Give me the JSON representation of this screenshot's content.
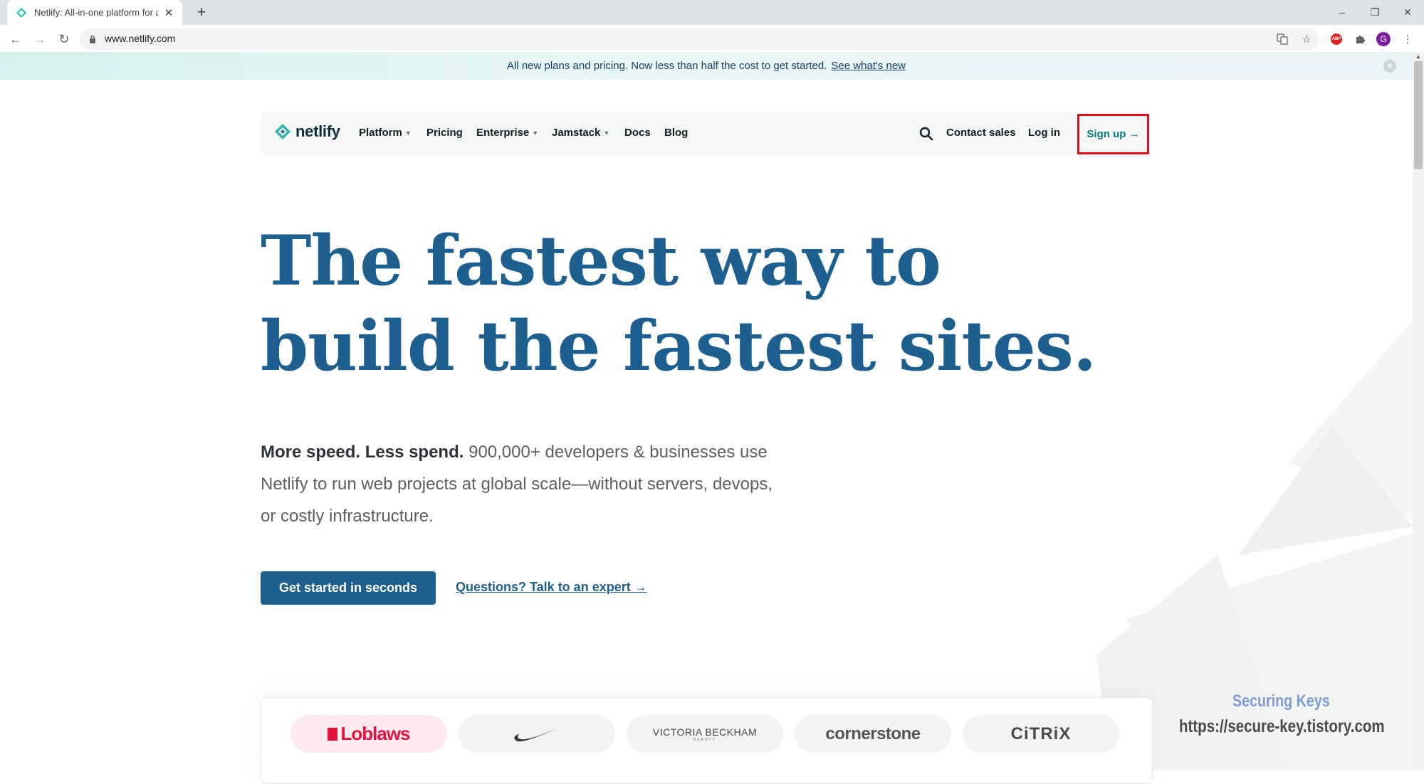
{
  "browser": {
    "tab_title": "Netlify: All-in-one platform for a",
    "new_tab": "+",
    "url": "www.netlify.com",
    "window": {
      "minimize": "–",
      "restore": "❐",
      "close": "✕"
    },
    "profile_initial": "G",
    "adblock_label": "ABP"
  },
  "announcement": {
    "text": "All new plans and pricing. Now less than half the cost to get started.",
    "link": "See what's new"
  },
  "nav": {
    "logo_text": "netlify",
    "items": [
      {
        "label": "Platform",
        "has_caret": true
      },
      {
        "label": "Pricing",
        "has_caret": false
      },
      {
        "label": "Enterprise",
        "has_caret": true
      },
      {
        "label": "Jamstack",
        "has_caret": true
      },
      {
        "label": "Docs",
        "has_caret": false
      },
      {
        "label": "Blog",
        "has_caret": false
      }
    ],
    "contact_sales": "Contact sales",
    "log_in": "Log in",
    "sign_up": "Sign up →"
  },
  "hero": {
    "line1": "The fastest way to",
    "line2": "build the fastest sites.",
    "sub_strong": "More speed. Less spend.",
    "sub_rest": " 900,000+ developers & businesses use Netlify to run web projects at global scale—without servers, devops, or costly infrastructure.",
    "cta": "Get started in seconds",
    "expert_link": "Questions? Talk to an expert →"
  },
  "customers": {
    "loblaws": "Loblaws",
    "victoria_beckham": "VICTORIA BECKHAM",
    "victoria_beckham_sub": "BEAUTY",
    "cornerstone": "cornerstone",
    "citrix": "CiTRiX"
  },
  "watermark": {
    "line1": "Securing Keys",
    "line2": "https://secure-key.tistory.com"
  },
  "colors": {
    "brand_blue": "#1d5f8f",
    "teal": "#047a81",
    "highlight_red": "#e00d1a"
  }
}
